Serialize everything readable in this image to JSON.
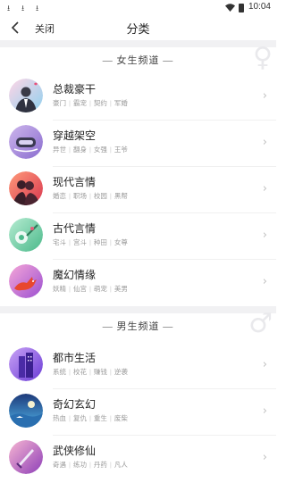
{
  "status_bar": {
    "time": "10:04",
    "download_icons": [
      "download-icon",
      "download-icon",
      "download-icon"
    ]
  },
  "header": {
    "close_label": "关闭",
    "title": "分类"
  },
  "sections": [
    {
      "title": "— 女生频道 —",
      "watermark_icon": "female-symbol-icon",
      "items": [
        {
          "name": "总裁豪干",
          "icon": "ceo-avatar-icon",
          "tags": [
            "豪门",
            "霸宠",
            "契约",
            "军婚"
          ]
        },
        {
          "name": "穿越架空",
          "icon": "time-travel-icon",
          "tags": [
            "异世",
            "翻身",
            "女强",
            "王爷"
          ]
        },
        {
          "name": "现代言情",
          "icon": "modern-romance-icon",
          "tags": [
            "婚恋",
            "职场",
            "校园",
            "黑帮"
          ]
        },
        {
          "name": "古代言情",
          "icon": "ancient-romance-icon",
          "tags": [
            "宅斗",
            "宫斗",
            "种田",
            "女尊"
          ]
        },
        {
          "name": "魔幻情缘",
          "icon": "fantasy-fox-icon",
          "tags": [
            "妖精",
            "仙宫",
            "萌宠",
            "美男"
          ]
        }
      ]
    },
    {
      "title": "— 男生频道 —",
      "watermark_icon": "male-symbol-icon",
      "items": [
        {
          "name": "都市生活",
          "icon": "city-life-icon",
          "tags": [
            "系统",
            "校花",
            "赚钱",
            "逆袭"
          ]
        },
        {
          "name": "奇幻玄幻",
          "icon": "fantasy-world-icon",
          "tags": [
            "热血",
            "复仇",
            "重生",
            "废柴"
          ]
        },
        {
          "name": "武侠修仙",
          "icon": "martial-arts-icon",
          "tags": [
            "奇遇",
            "练功",
            "丹药",
            "凡人"
          ]
        }
      ]
    }
  ]
}
